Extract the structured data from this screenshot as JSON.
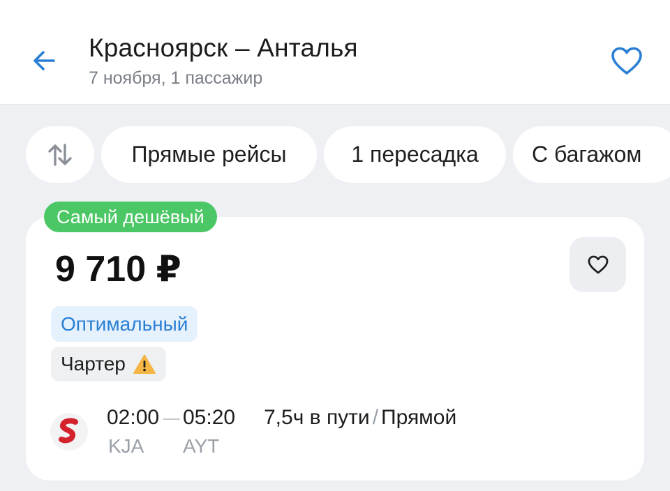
{
  "header": {
    "title": "Красноярск – Анталья",
    "subtitle": "7 ноября, 1 пассажир"
  },
  "filters": [
    {
      "label": "Прямые рейсы"
    },
    {
      "label": "1 пересадка"
    },
    {
      "label": "С багажом"
    }
  ],
  "result": {
    "badge": "Самый дешёвый",
    "price": "9 710 ₽",
    "tags": {
      "optimal": "Оптимальный",
      "charter": "Чартер"
    },
    "flight": {
      "departure_time": "02:00",
      "arrival_time": "05:20",
      "departure_code": "KJA",
      "arrival_code": "AYT",
      "duration": "7,5ч в пути",
      "separator": "/",
      "type": "Прямой"
    }
  },
  "colors": {
    "accent": "#2a7fd4",
    "badge_green": "#4cc765",
    "warning": "#f4b544",
    "airline_red": "#d3232d"
  },
  "icons": {
    "back": "arrow-left-icon",
    "favorite": "heart-icon",
    "sort": "sort-arrows-icon",
    "warning": "warning-icon",
    "airline": "airline-logo-icon"
  }
}
